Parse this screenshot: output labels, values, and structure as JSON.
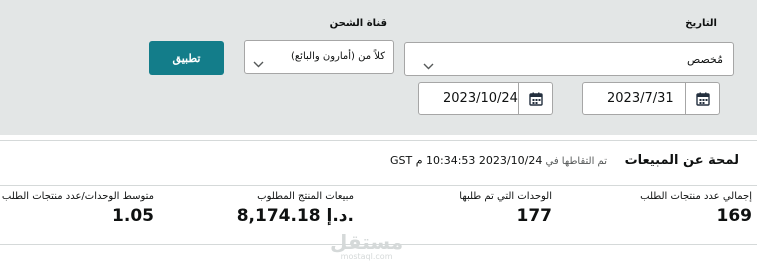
{
  "filters": {
    "date_label": "التاريخ",
    "date_selected": "مُخصص",
    "channel_label": "قناة الشحن",
    "channel_selected": "كلاً من (أمارون والبائع)",
    "apply_label": "تطبيق",
    "start_date": "2023/7/31",
    "end_date": "2023/10/24"
  },
  "summary": {
    "title": "لمحة عن المبيعات",
    "captured_prefix": "تم التقاطها في",
    "captured_time": "2023/10/24 10:34:53 م GST",
    "metrics": [
      {
        "label": "إجمالي عدد منتجات الطلب",
        "value": "169"
      },
      {
        "label": "الوحدات التي تم طلبها",
        "value": "177"
      },
      {
        "label": "مبيعات المنتج المطلوب",
        "value": "8,174.18 د.إ."
      },
      {
        "label": "متوسط الوحدات/عدد منتجات الطلب",
        "value": "1.05"
      }
    ]
  },
  "watermark": {
    "text": "مستقل",
    "sub": "mostaql.com"
  },
  "colors": {
    "panel": "#e3e6e6",
    "primary": "#137d8a"
  }
}
